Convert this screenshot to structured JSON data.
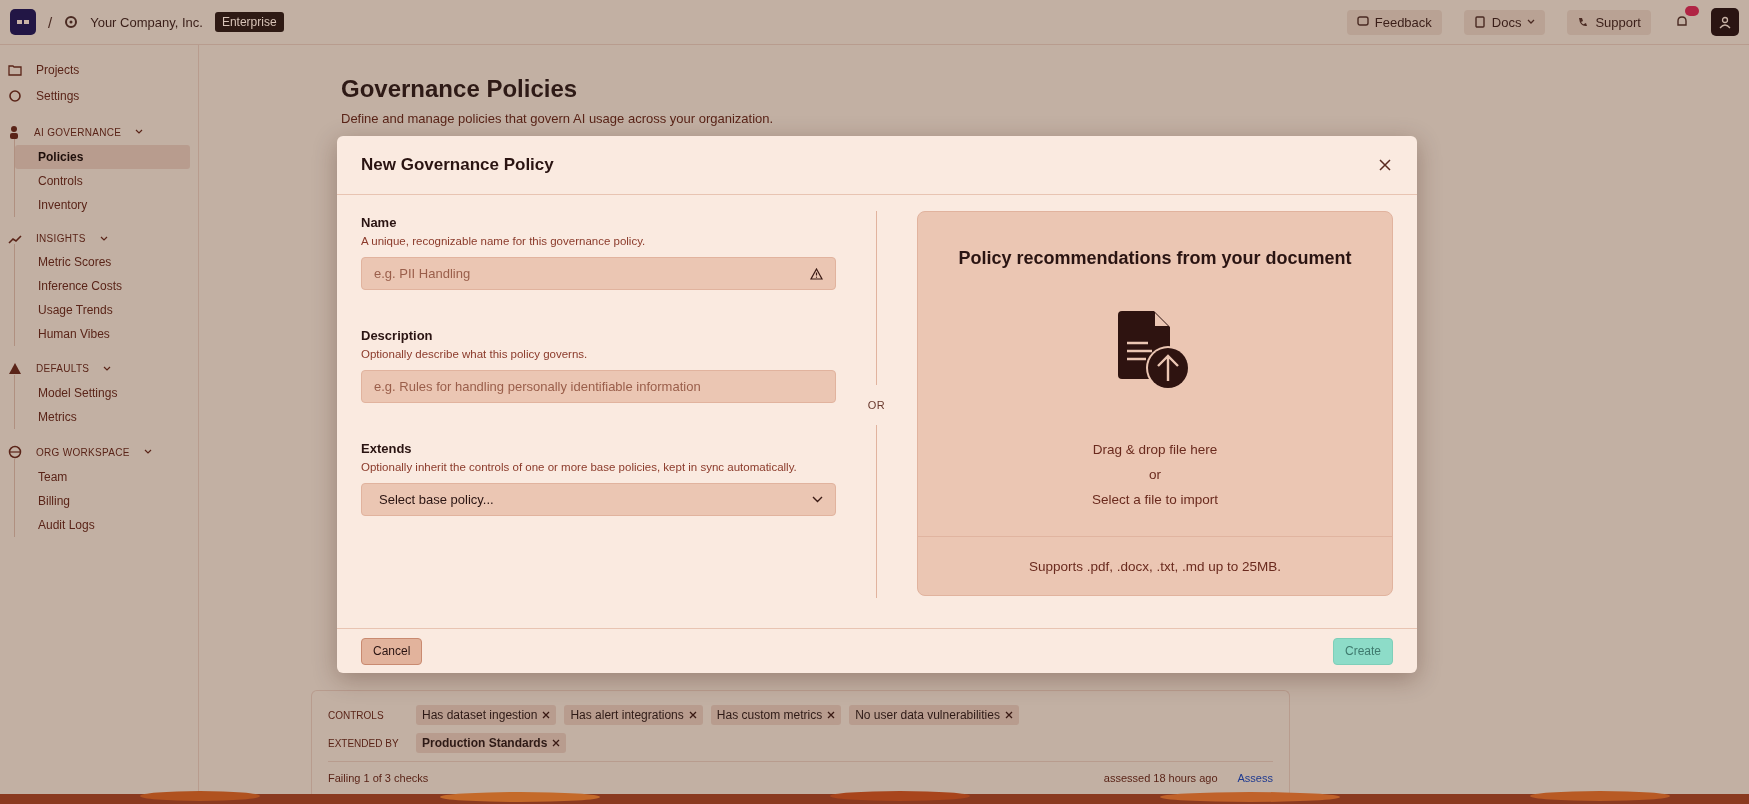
{
  "top_bar": {
    "separator": "/",
    "org": "Your Company, Inc.",
    "plan_badge": "Enterprise",
    "actions": [
      {
        "label": "Feedback",
        "kind": "feedback"
      },
      {
        "label": "Docs",
        "kind": "docs"
      },
      {
        "label": "Support",
        "kind": "support"
      }
    ]
  },
  "sidebar": {
    "items": [
      {
        "label": "Projects",
        "kind": "folder",
        "selected": false
      },
      {
        "label": "Settings",
        "kind": "gear",
        "selected": false
      }
    ],
    "sections": [
      {
        "title": "AI GOVERNANCE",
        "kind": "person",
        "items": [
          {
            "label": "Policies",
            "selected": true
          },
          {
            "label": "Controls",
            "selected": false
          },
          {
            "label": "Inventory",
            "selected": false
          }
        ]
      },
      {
        "title": "INSIGHTS",
        "kind": "trend",
        "items": [
          {
            "label": "Metric Scores",
            "selected": false
          },
          {
            "label": "Inference Costs",
            "selected": false
          },
          {
            "label": "Usage Trends",
            "selected": false
          },
          {
            "label": "Human Vibes",
            "selected": false
          }
        ]
      },
      {
        "title": "DEFAULTS",
        "kind": "warning",
        "items": [
          {
            "label": "Model Settings",
            "selected": false
          },
          {
            "label": "Metrics",
            "selected": false
          }
        ]
      },
      {
        "title": "ORG WORKSPACE",
        "kind": "globe",
        "items": [
          {
            "label": "Team",
            "selected": false
          },
          {
            "label": "Billing",
            "selected": false
          },
          {
            "label": "Audit Logs",
            "selected": false
          }
        ]
      }
    ]
  },
  "page": {
    "title": "Governance Policies",
    "subtitle": "Define and manage policies that govern AI usage across your organization.",
    "policy_card": {
      "controls_label": "CONTROLS",
      "controls": [
        "Has dataset ingestion",
        "Has alert integrations",
        "Has custom metrics",
        "No user data vulnerabilities"
      ],
      "extended_by_label": "EXTENDED BY",
      "extended_by": [
        "Production Standards"
      ],
      "status": "Failing 1 of 3 checks",
      "assessed": "assessed 18 hours ago",
      "action": "Assess"
    }
  },
  "dialog": {
    "title": "New Governance Policy",
    "fields": [
      {
        "kind": "text",
        "label": "Name",
        "help": "A unique, recognizable name for this governance policy.",
        "placeholder": "e.g. PII Handling",
        "warning": true
      },
      {
        "kind": "text",
        "label": "Description",
        "help": "Optionally describe what this policy governs.",
        "placeholder": "e.g. Rules for handling personally identifiable information",
        "warning": false
      },
      {
        "kind": "select",
        "label": "Extends",
        "help": "Optionally inherit the controls of one or more base policies, kept in sync automatically.",
        "value": "Select base policy..."
      }
    ],
    "divider_label": "OR",
    "import": {
      "title": "Policy recommendations from your document",
      "drop_text": "Drag & drop file here",
      "or": "or",
      "select_text": "Select a file to import",
      "note": "Supports .pdf, .docx, .txt, .md up to 25MB."
    },
    "cancel": "Cancel",
    "create": {
      "label": "Create",
      "disabled": true
    }
  }
}
